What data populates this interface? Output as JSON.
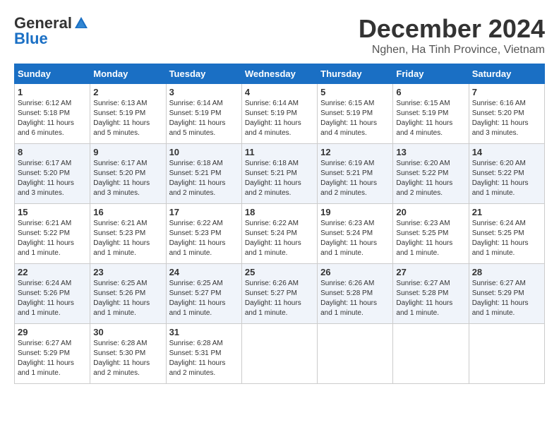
{
  "header": {
    "logo_general": "General",
    "logo_blue": "Blue",
    "month_title": "December 2024",
    "location": "Nghen, Ha Tinh Province, Vietnam"
  },
  "weekdays": [
    "Sunday",
    "Monday",
    "Tuesday",
    "Wednesday",
    "Thursday",
    "Friday",
    "Saturday"
  ],
  "weeks": [
    [
      {
        "day": "1",
        "sunrise": "6:12 AM",
        "sunset": "5:18 PM",
        "daylight": "11 hours and 6 minutes."
      },
      {
        "day": "2",
        "sunrise": "6:13 AM",
        "sunset": "5:19 PM",
        "daylight": "11 hours and 5 minutes."
      },
      {
        "day": "3",
        "sunrise": "6:14 AM",
        "sunset": "5:19 PM",
        "daylight": "11 hours and 5 minutes."
      },
      {
        "day": "4",
        "sunrise": "6:14 AM",
        "sunset": "5:19 PM",
        "daylight": "11 hours and 4 minutes."
      },
      {
        "day": "5",
        "sunrise": "6:15 AM",
        "sunset": "5:19 PM",
        "daylight": "11 hours and 4 minutes."
      },
      {
        "day": "6",
        "sunrise": "6:15 AM",
        "sunset": "5:19 PM",
        "daylight": "11 hours and 4 minutes."
      },
      {
        "day": "7",
        "sunrise": "6:16 AM",
        "sunset": "5:20 PM",
        "daylight": "11 hours and 3 minutes."
      }
    ],
    [
      {
        "day": "8",
        "sunrise": "6:17 AM",
        "sunset": "5:20 PM",
        "daylight": "11 hours and 3 minutes."
      },
      {
        "day": "9",
        "sunrise": "6:17 AM",
        "sunset": "5:20 PM",
        "daylight": "11 hours and 3 minutes."
      },
      {
        "day": "10",
        "sunrise": "6:18 AM",
        "sunset": "5:21 PM",
        "daylight": "11 hours and 2 minutes."
      },
      {
        "day": "11",
        "sunrise": "6:18 AM",
        "sunset": "5:21 PM",
        "daylight": "11 hours and 2 minutes."
      },
      {
        "day": "12",
        "sunrise": "6:19 AM",
        "sunset": "5:21 PM",
        "daylight": "11 hours and 2 minutes."
      },
      {
        "day": "13",
        "sunrise": "6:20 AM",
        "sunset": "5:22 PM",
        "daylight": "11 hours and 2 minutes."
      },
      {
        "day": "14",
        "sunrise": "6:20 AM",
        "sunset": "5:22 PM",
        "daylight": "11 hours and 1 minute."
      }
    ],
    [
      {
        "day": "15",
        "sunrise": "6:21 AM",
        "sunset": "5:22 PM",
        "daylight": "11 hours and 1 minute."
      },
      {
        "day": "16",
        "sunrise": "6:21 AM",
        "sunset": "5:23 PM",
        "daylight": "11 hours and 1 minute."
      },
      {
        "day": "17",
        "sunrise": "6:22 AM",
        "sunset": "5:23 PM",
        "daylight": "11 hours and 1 minute."
      },
      {
        "day": "18",
        "sunrise": "6:22 AM",
        "sunset": "5:24 PM",
        "daylight": "11 hours and 1 minute."
      },
      {
        "day": "19",
        "sunrise": "6:23 AM",
        "sunset": "5:24 PM",
        "daylight": "11 hours and 1 minute."
      },
      {
        "day": "20",
        "sunrise": "6:23 AM",
        "sunset": "5:25 PM",
        "daylight": "11 hours and 1 minute."
      },
      {
        "day": "21",
        "sunrise": "6:24 AM",
        "sunset": "5:25 PM",
        "daylight": "11 hours and 1 minute."
      }
    ],
    [
      {
        "day": "22",
        "sunrise": "6:24 AM",
        "sunset": "5:26 PM",
        "daylight": "11 hours and 1 minute."
      },
      {
        "day": "23",
        "sunrise": "6:25 AM",
        "sunset": "5:26 PM",
        "daylight": "11 hours and 1 minute."
      },
      {
        "day": "24",
        "sunrise": "6:25 AM",
        "sunset": "5:27 PM",
        "daylight": "11 hours and 1 minute."
      },
      {
        "day": "25",
        "sunrise": "6:26 AM",
        "sunset": "5:27 PM",
        "daylight": "11 hours and 1 minute."
      },
      {
        "day": "26",
        "sunrise": "6:26 AM",
        "sunset": "5:28 PM",
        "daylight": "11 hours and 1 minute."
      },
      {
        "day": "27",
        "sunrise": "6:27 AM",
        "sunset": "5:28 PM",
        "daylight": "11 hours and 1 minute."
      },
      {
        "day": "28",
        "sunrise": "6:27 AM",
        "sunset": "5:29 PM",
        "daylight": "11 hours and 1 minute."
      }
    ],
    [
      {
        "day": "29",
        "sunrise": "6:27 AM",
        "sunset": "5:29 PM",
        "daylight": "11 hours and 1 minute."
      },
      {
        "day": "30",
        "sunrise": "6:28 AM",
        "sunset": "5:30 PM",
        "daylight": "11 hours and 2 minutes."
      },
      {
        "day": "31",
        "sunrise": "6:28 AM",
        "sunset": "5:31 PM",
        "daylight": "11 hours and 2 minutes."
      },
      null,
      null,
      null,
      null
    ]
  ],
  "labels": {
    "sunrise": "Sunrise:",
    "sunset": "Sunset:",
    "daylight": "Daylight:"
  }
}
